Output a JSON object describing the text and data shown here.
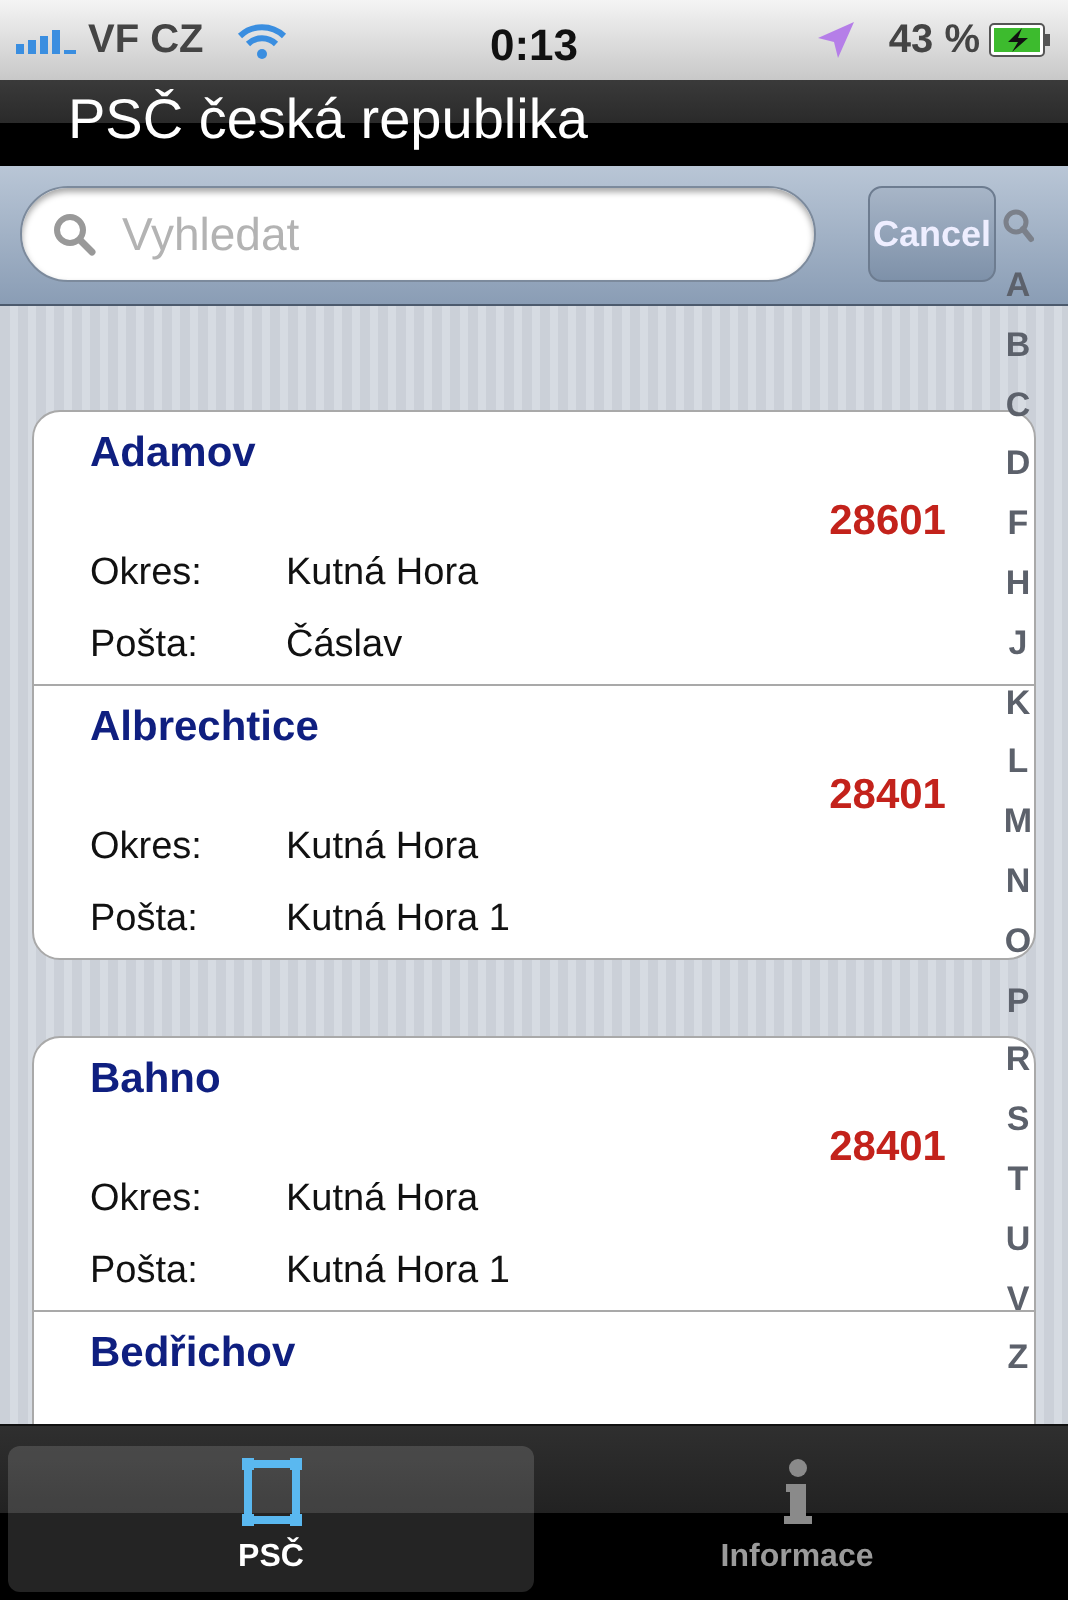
{
  "status_bar": {
    "carrier": "VF CZ",
    "time": "0:13",
    "battery": "43 %"
  },
  "nav_bar": {
    "title": "PSČ česká republika"
  },
  "search": {
    "placeholder": "Vyhledat",
    "cancel": "Cancel"
  },
  "sections": [
    {
      "rows": [
        {
          "name": "Adamov",
          "zip": "28601",
          "fields": [
            {
              "label": "Okres:",
              "value": "Kutná Hora"
            },
            {
              "label": "Pošta:",
              "value": "Čáslav"
            }
          ]
        },
        {
          "name": "Albrechtice",
          "zip": "28401",
          "fields": [
            {
              "label": "Okres:",
              "value": "Kutná Hora"
            },
            {
              "label": "Pošta:",
              "value": "Kutná Hora 1"
            }
          ]
        }
      ]
    },
    {
      "rows": [
        {
          "name": "Bahno",
          "zip": "28401",
          "fields": [
            {
              "label": "Okres:",
              "value": "Kutná Hora"
            },
            {
              "label": "Pošta:",
              "value": "Kutná Hora 1"
            }
          ]
        },
        {
          "name": "Bedřichov",
          "fields": []
        }
      ]
    }
  ],
  "index": [
    "A",
    "B",
    "C",
    "D",
    "F",
    "H",
    "J",
    "K",
    "L",
    "M",
    "N",
    "O",
    "P",
    "R",
    "S",
    "T",
    "U",
    "V",
    "Z"
  ],
  "tabs": [
    {
      "label": "PSČ",
      "kind": "zip",
      "selected": true
    },
    {
      "label": "Informace",
      "kind": "info",
      "selected": false
    }
  ]
}
